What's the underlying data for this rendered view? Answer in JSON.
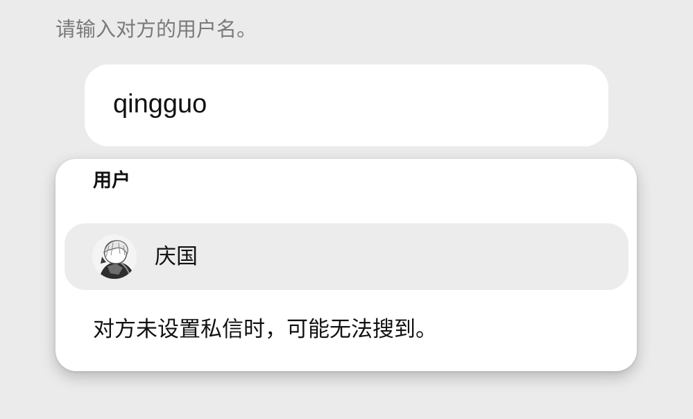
{
  "prompt": {
    "text": "请输入对方的用户名。"
  },
  "search": {
    "value": "qingguo"
  },
  "results": {
    "section_title": "用户",
    "users": [
      {
        "name": "庆国",
        "avatar": "manga-character-avatar"
      }
    ],
    "note": "对方未设置私信时，可能无法搜到。"
  },
  "colors": {
    "background": "#ebebeb",
    "prompt_text": "#7a7a7a",
    "card": "#ffffff",
    "selected_row": "#ececec",
    "text": "#111111"
  }
}
